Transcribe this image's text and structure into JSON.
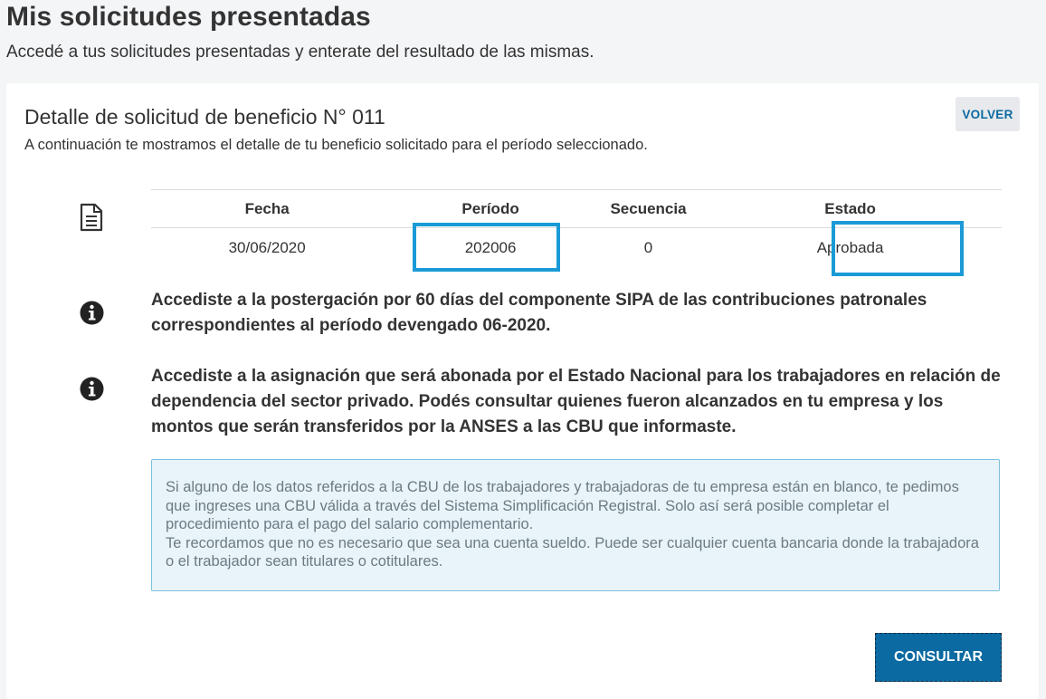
{
  "header": {
    "title": "Mis solicitudes presentadas",
    "subtitle": "Accedé a tus solicitudes presentadas y enterate del resultado de las mismas."
  },
  "detail": {
    "title": "Detalle de solicitud de beneficio N° 011",
    "description": "A continuación te mostramos el detalle de tu beneficio solicitado para el período seleccionado.",
    "back_label": "VOLVER"
  },
  "table": {
    "columns": [
      "Fecha",
      "Período",
      "Secuencia",
      "Estado"
    ],
    "row": [
      "30/06/2020",
      "202006",
      "0",
      "Aprobada"
    ]
  },
  "info": [
    "Accediste a la postergación por 60 días del componente SIPA de las contribuciones patronales correspondientes al período devengado 06-2020.",
    "Accediste a la asignación que será abonada por el Estado Nacional para los trabajadores en relación de dependencia del sector privado. Podés consultar quienes fueron alcanzados en tu empresa y los montos que serán transferidos por la ANSES a las CBU que informaste."
  ],
  "alert": {
    "paragraph1": "Si alguno de los datos referidos a la CBU de los trabajadores y trabajadoras de tu empresa están en blanco, te pedimos que ingreses una CBU válida a través del Sistema Simplificación Registral. Solo así será posible completar el procedimiento para el pago del salario complementario.",
    "paragraph2": "Te recordamos que no es necesario que sea una cuenta sueldo. Puede ser cualquier cuenta bancaria donde la trabajadora o el trabajador sean titulares o cotitulares."
  },
  "actions": {
    "consultar_label": "CONSULTAR"
  },
  "colors": {
    "primary": "#0a6aa1",
    "highlight": "#1a9ad6",
    "alert_bg": "#e8f4fa",
    "alert_border": "#7cc0df"
  },
  "icons": [
    "document-icon",
    "info-icon"
  ]
}
